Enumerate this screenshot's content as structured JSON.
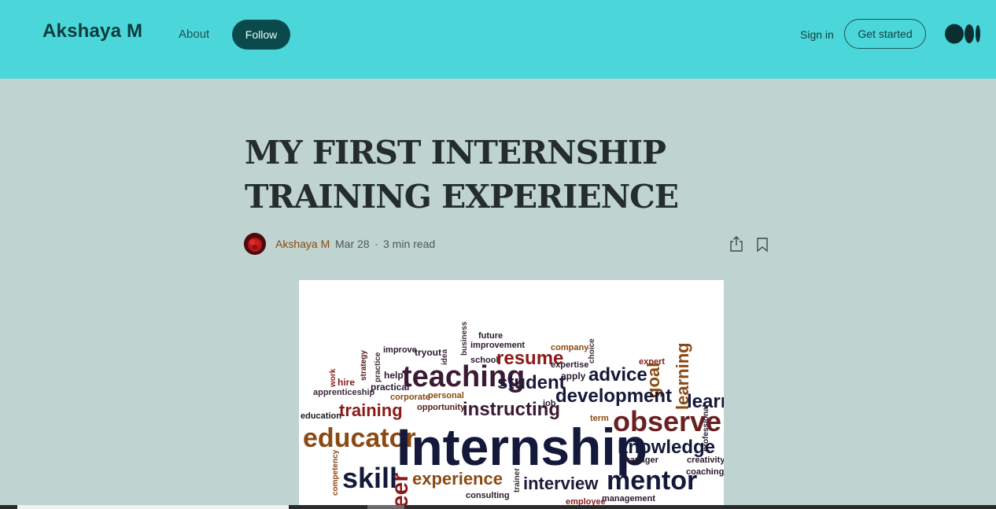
{
  "header": {
    "brand": "Akshaya M",
    "about": "About",
    "follow": "Follow",
    "sign_in": "Sign in",
    "get_started": "Get started",
    "logo_icon": "medium-logo-icon",
    "bg_color": "#4bd7d9"
  },
  "article": {
    "title_line1": "MY FIRST INTERNSHIP",
    "title_line2": "TRAINING EXPERIENCE",
    "author": "Akshaya M",
    "date": "Mar 28",
    "separator": "·",
    "read_time": "3 min read",
    "share_icon": "share-icon",
    "bookmark_icon": "bookmark-icon"
  },
  "hero_image": {
    "words": [
      "future",
      "business",
      "improve",
      "improvement",
      "company",
      "choice",
      "tryout",
      "idea",
      "school",
      "resume",
      "expertise",
      "expert",
      "strategy",
      "practice",
      "help",
      "teaching",
      "apply",
      "advice",
      "goal",
      "learning",
      "work",
      "hire",
      "practical",
      "student",
      "development",
      "learn",
      "apprenticeship",
      "corporate",
      "personal",
      "opportunity",
      "job",
      "instructing",
      "education",
      "training",
      "term",
      "observe",
      "professional",
      "educator",
      "Internship",
      "knowledge",
      "manager",
      "creativity",
      "competency",
      "skill",
      "eer",
      "experience",
      "trainer",
      "interview",
      "mentor",
      "coaching",
      "consulting",
      "employee",
      "management"
    ]
  },
  "colors": {
    "page_bg": "#bfd3d1",
    "accent": "#0b4a4c",
    "author_color": "#8a4a14"
  }
}
